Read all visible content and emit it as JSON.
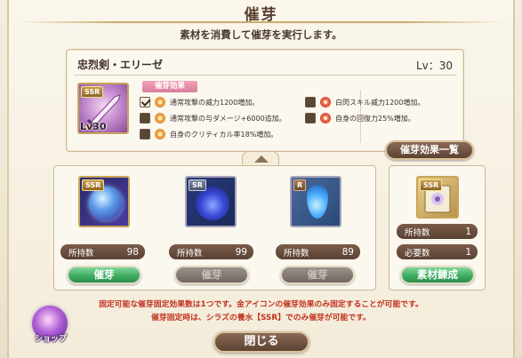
{
  "header": {
    "title": "催芽",
    "subtitle": "素材を消費して催芽を実行します。"
  },
  "character": {
    "name": "忠烈剣・エリーゼ",
    "level_label": "Lv：30",
    "weapon_rarity": "SSR",
    "weapon_level": "Lv30",
    "effect_tag": "催芽効果"
  },
  "effects": [
    {
      "checked": true,
      "icon": "flame-icon",
      "text": "通常攻撃の威力1200増加。"
    },
    {
      "checked": false,
      "icon": "flame-icon",
      "text": "通常攻撃の与ダメージ+6000追加。"
    },
    {
      "checked": false,
      "icon": "crit-icon",
      "text": "自身のクリティカル率18%増加。"
    },
    {
      "checked": false,
      "icon": "skill-icon",
      "text": "白閃スキル威力1200増加。"
    },
    {
      "checked": false,
      "icon": "heal-icon",
      "text": "自身の回復力25%増加。"
    }
  ],
  "effect_list_button": "催芽効果一覧",
  "materials": [
    {
      "rarity": "SSR",
      "owned_label": "所持数",
      "owned": "98",
      "button": "催芽",
      "enabled": true
    },
    {
      "rarity": "SR",
      "owned_label": "所持数",
      "owned": "99",
      "button": "催芽",
      "enabled": false
    },
    {
      "rarity": "R",
      "owned_label": "所持数",
      "owned": "89",
      "button": "催芽",
      "enabled": false
    }
  ],
  "refine": {
    "rarity": "SSR",
    "owned_label": "所持数",
    "owned": "1",
    "required_label": "必要数",
    "required": "1",
    "button": "素材錬成"
  },
  "notes": [
    "固定可能な催芽固定効果数は1つです。金アイコンの催芽効果のみ固定することが可能です。",
    "催芽固定時は、シラズの養水【SSR】でのみ催芽が可能です。"
  ],
  "close_button": "閉じる",
  "shop_label": "ショップ",
  "colors": {
    "accent_green": "#3fae62",
    "button_brown": "#5c4232",
    "note_red": "#c0321e",
    "effect_tag_pink": "#d87c98"
  }
}
